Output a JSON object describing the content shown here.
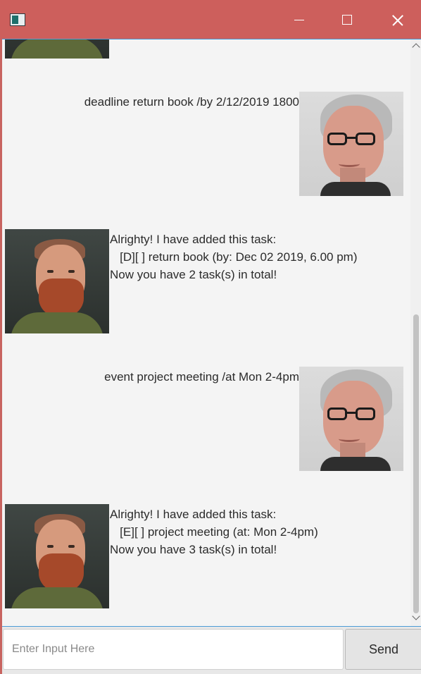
{
  "window": {
    "icon": "app-window-icon",
    "controls": {
      "minimize": "minimize-icon",
      "maximize": "maximize-icon",
      "close": "close-icon"
    }
  },
  "messages": [
    {
      "from": "bot",
      "text": ""
    },
    {
      "from": "user",
      "text": "deadline return book /by 2/12/2019 1800"
    },
    {
      "from": "bot",
      "text": "Alrighty! I have added this task:\n   [D][ ] return book (by: Dec 02 2019, 6.00 pm)\nNow you have 2 task(s) in total!"
    },
    {
      "from": "user",
      "text": "event project meeting /at Mon 2-4pm"
    },
    {
      "from": "bot",
      "text": "Alrighty! I have added this task:\n   [E][ ] project meeting (at: Mon 2-4pm)\nNow you have 3 task(s) in total!"
    }
  ],
  "input": {
    "placeholder": "Enter Input Here",
    "value": ""
  },
  "send_button": {
    "label": "Send"
  },
  "colors": {
    "titlebar": "#cd5f5c",
    "accent_border": "#4b9bd6",
    "background": "#f4f4f4"
  }
}
